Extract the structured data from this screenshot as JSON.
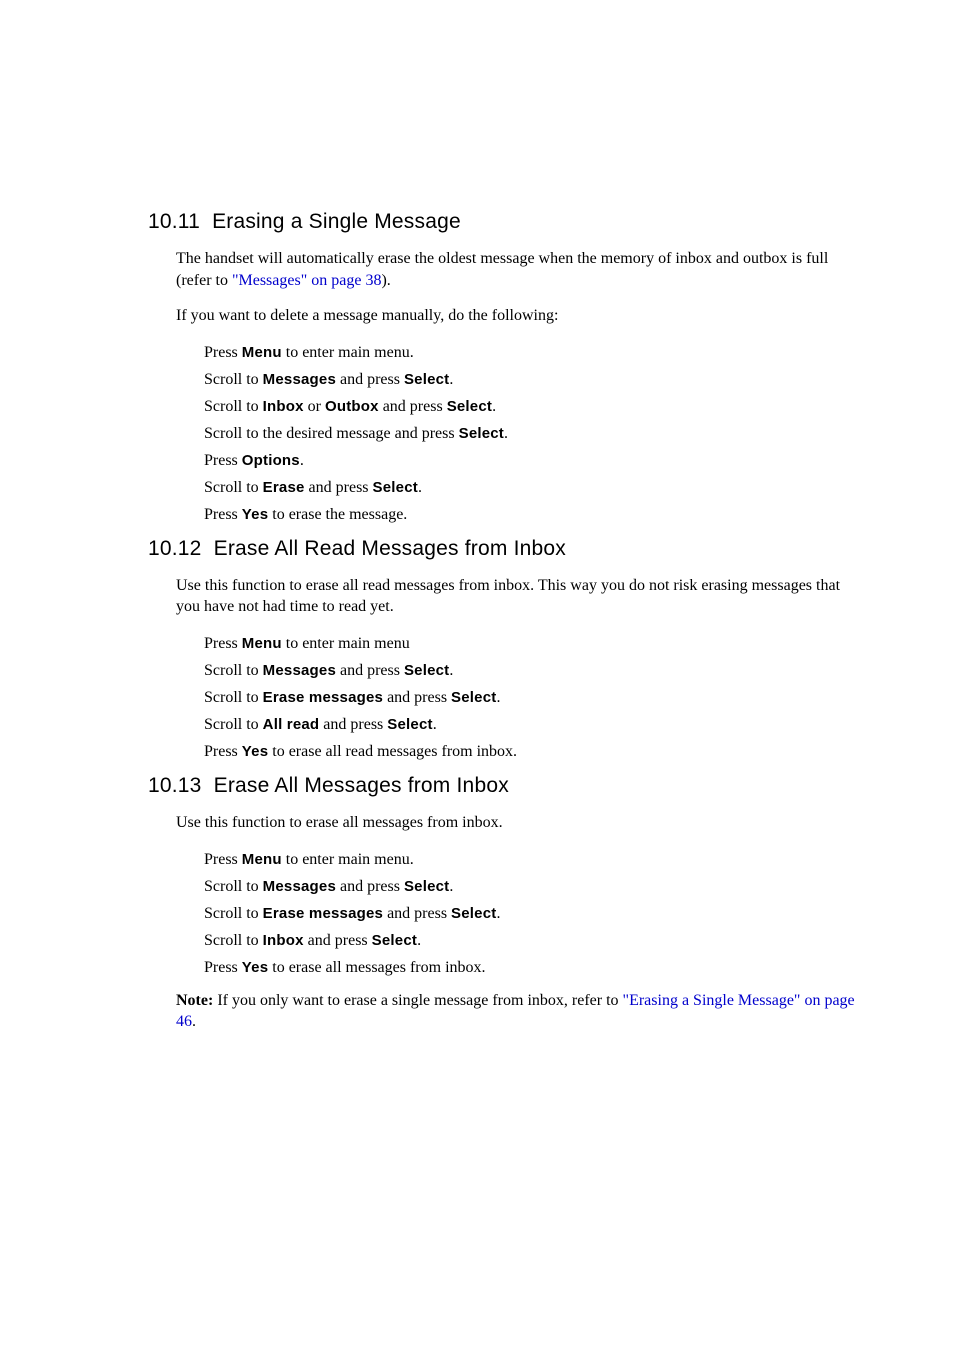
{
  "section1": {
    "number": "10.11",
    "title": "Erasing a Single Message",
    "para1_a": "The handset will automatically erase the oldest message when the memory of inbox and outbox is full (refer to ",
    "para1_link": "\"Messages\" on page 38",
    "para1_b": ").",
    "para2": "If you want to delete a message manually, do the following:",
    "steps": {
      "s1_a": "Press ",
      "s1_u": "Menu",
      "s1_b": " to enter main menu.",
      "s2_a": "Scroll to ",
      "s2_u": "Messages",
      "s2_b": " and press ",
      "s2_u2": "Select",
      "s2_c": ".",
      "s3_a": "Scroll to ",
      "s3_u": "Inbox",
      "s3_b": " or ",
      "s3_u2": "Outbox",
      "s3_c": " and press ",
      "s3_u3": "Select",
      "s3_d": ".",
      "s4_a": "Scroll to the desired message and press ",
      "s4_u": "Select",
      "s4_b": ".",
      "s5_a": "Press ",
      "s5_u": "Options",
      "s5_b": ".",
      "s6_a": "Scroll to ",
      "s6_u": "Erase",
      "s6_b": " and press ",
      "s6_u2": "Select",
      "s6_c": ".",
      "s7_a": "Press ",
      "s7_u": "Yes",
      "s7_b": " to erase the message."
    }
  },
  "section2": {
    "number": "10.12",
    "title": "Erase All Read Messages from Inbox",
    "para": "Use this function to erase all read messages from inbox. This way you do not risk erasing messages that you have not had time to read yet.",
    "steps": {
      "s1_a": "Press ",
      "s1_u": "Menu",
      "s1_b": " to enter main menu",
      "s2_a": "Scroll to ",
      "s2_u": "Messages",
      "s2_b": " and press ",
      "s2_u2": "Select",
      "s2_c": ".",
      "s3_a": "Scroll to ",
      "s3_u": "Erase messages",
      "s3_b": " and press ",
      "s3_u2": "Select",
      "s3_c": ".",
      "s4_a": "Scroll to ",
      "s4_u": "All read",
      "s4_b": " and press ",
      "s4_u2": "Select",
      "s4_c": ".",
      "s5_a": "Press ",
      "s5_u": "Yes",
      "s5_b": " to erase all read messages from inbox."
    }
  },
  "section3": {
    "number": "10.13",
    "title": "Erase All Messages from Inbox",
    "para": "Use this function to erase all messages from inbox.",
    "steps": {
      "s1_a": "Press ",
      "s1_u": "Menu",
      "s1_b": " to enter main menu.",
      "s2_a": "Scroll to ",
      "s2_u": "Messages",
      "s2_b": " and press ",
      "s2_u2": "Select",
      "s2_c": ".",
      "s3_a": "Scroll to ",
      "s3_u": "Erase messages",
      "s3_b": " and press ",
      "s3_u2": "Select",
      "s3_c": ".",
      "s4_a": "Scroll to ",
      "s4_u": "Inbox",
      "s4_b": " and press ",
      "s4_u2": "Select",
      "s4_c": ".",
      "s5_a": "Press ",
      "s5_u": "Yes",
      "s5_b": " to erase all messages from inbox."
    },
    "note_label": "Note:",
    "note_a": " If you only want to erase a single message from inbox, refer to ",
    "note_link": "\"Erasing a Single Message\" on page 46",
    "note_b": "."
  }
}
